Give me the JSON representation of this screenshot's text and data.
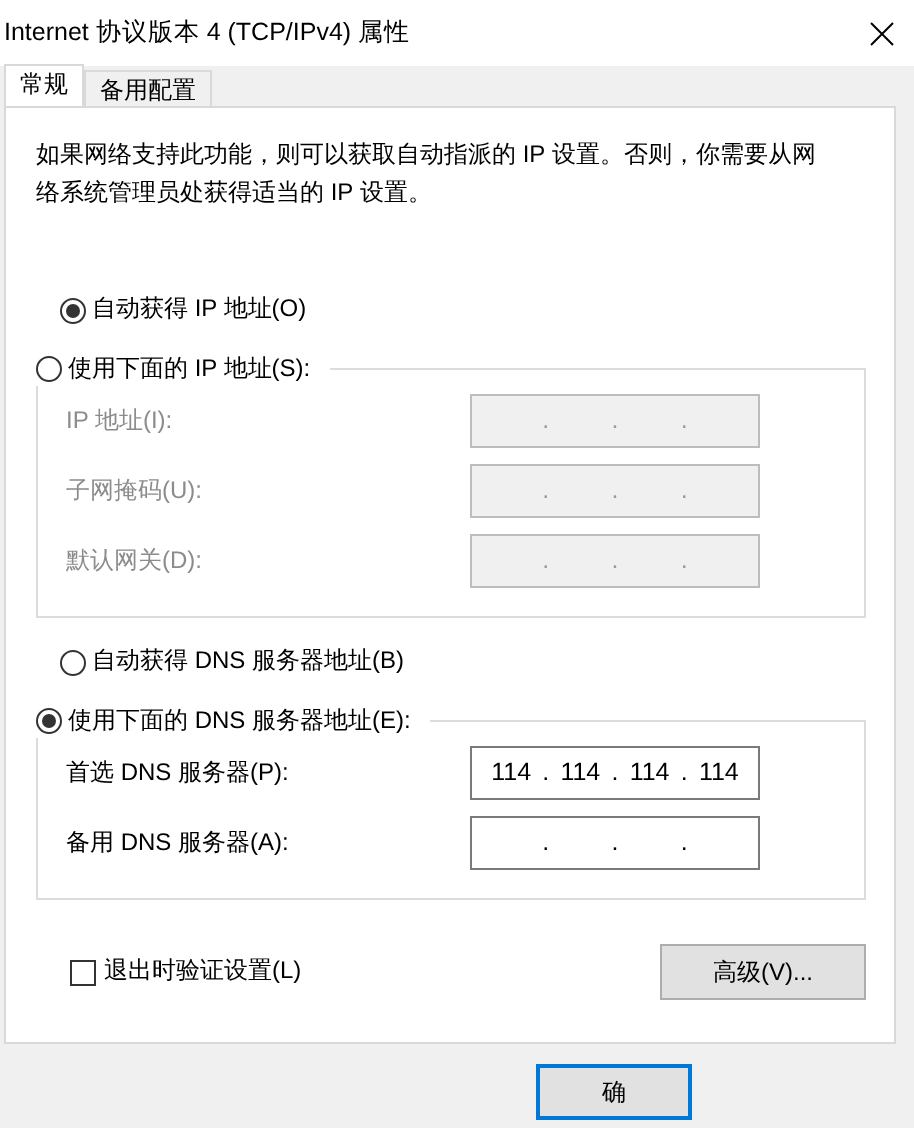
{
  "window": {
    "title": "Internet 协议版本 4 (TCP/IPv4) 属性"
  },
  "tabs": [
    {
      "label": "常规",
      "selected": true
    },
    {
      "label": "备用配置",
      "selected": false
    }
  ],
  "description": "如果网络支持此功能，则可以获取自动指派的 IP 设置。否则，你需要从网络系统管理员处获得适当的 IP 设置。",
  "ip_settings": {
    "auto_option": {
      "label": "自动获得 IP 地址(O)",
      "selected": true
    },
    "manual_option": {
      "label": "使用下面的 IP 地址(S):",
      "selected": false
    },
    "fields": [
      {
        "label": "IP 地址(I):",
        "disabled": true,
        "separators": [
          ".",
          ".",
          "."
        ]
      },
      {
        "label": "子网掩码(U):",
        "disabled": true,
        "separators": [
          ".",
          ".",
          "."
        ]
      },
      {
        "label": "默认网关(D):",
        "disabled": true,
        "separators": [
          ".",
          ".",
          "."
        ]
      }
    ]
  },
  "dns_settings": {
    "auto_option": {
      "label": "自动获得 DNS 服务器地址(B)",
      "selected": false
    },
    "manual_option": {
      "label": "使用下面的 DNS 服务器地址(E):",
      "selected": true
    },
    "fields": [
      {
        "label": "首选 DNS 服务器(P):",
        "disabled": false,
        "separators": [
          ".",
          ".",
          "."
        ],
        "octets": [
          "114",
          "114",
          "114",
          "114"
        ]
      },
      {
        "label": "备用 DNS 服务器(A):",
        "disabled": false,
        "separators": [
          ".",
          ".",
          "."
        ]
      }
    ]
  },
  "validate_on_exit": {
    "label": "退出时验证设置(L)",
    "checked": false
  },
  "advanced_button": "高级(V)...",
  "ok_button": "确"
}
